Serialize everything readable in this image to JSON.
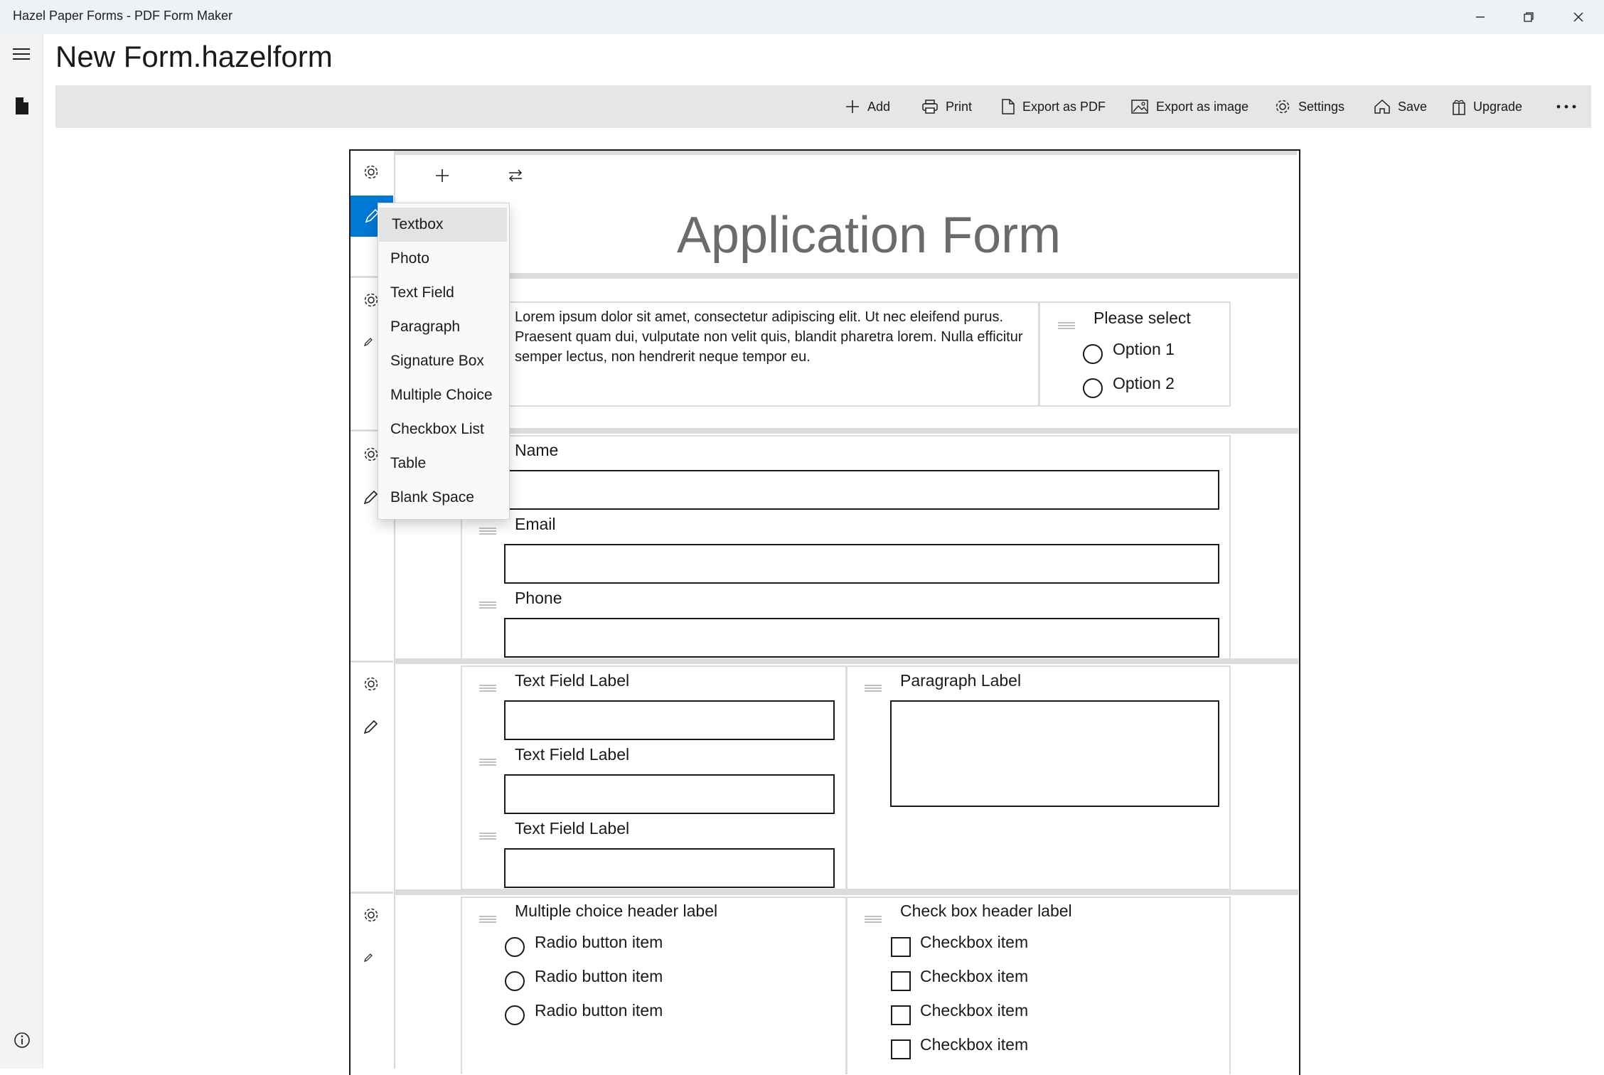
{
  "window": {
    "title": "Hazel Paper Forms - PDF Form Maker"
  },
  "document": {
    "title": "New Form.hazelform"
  },
  "toolbar": {
    "add": "Add",
    "print": "Print",
    "export_pdf": "Export as PDF",
    "export_image": "Export as image",
    "settings": "Settings",
    "save": "Save",
    "upgrade": "Upgrade"
  },
  "add_menu": {
    "items": [
      "Textbox",
      "Photo",
      "Text Field",
      "Paragraph",
      "Signature Box",
      "Multiple Choice",
      "Checkbox List",
      "Table",
      "Blank Space"
    ],
    "highlighted": "Textbox"
  },
  "form": {
    "title": "Application Form",
    "intro_text": "Lorem ipsum dolor sit amet, consectetur adipiscing elit. Ut nec eleifend purus. Praesent quam dui, vulputate non velit quis, blandit pharetra lorem. Nulla efficitur semper lectus, non hendrerit neque tempor eu.",
    "select": {
      "label": "Please select",
      "options": [
        "Option 1",
        "Option 2"
      ]
    },
    "contact_fields": [
      "Name",
      "Email",
      "Phone"
    ],
    "text_fields": [
      "Text Field Label",
      "Text Field Label",
      "Text Field Label"
    ],
    "paragraph_label": "Paragraph Label",
    "multiple_choice": {
      "header": "Multiple choice header label",
      "items": [
        "Radio button item",
        "Radio button item",
        "Radio button item"
      ]
    },
    "checkbox_list": {
      "header": "Check box header label",
      "items": [
        "Checkbox item",
        "Checkbox item",
        "Checkbox item",
        "Checkbox item"
      ]
    }
  },
  "colors": {
    "accent": "#0078d4",
    "titlebar": "#eef1f6",
    "toolbar": "#e6e6e6",
    "form_title": "#6b6b6b"
  }
}
